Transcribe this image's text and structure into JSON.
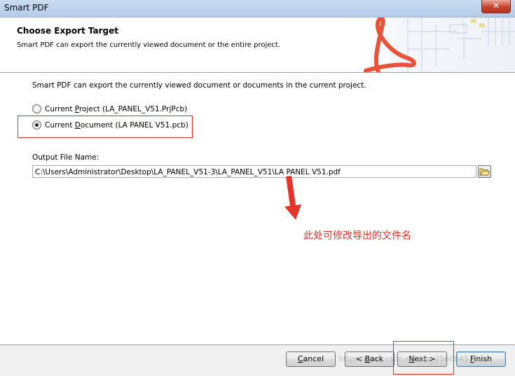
{
  "window": {
    "title": "Smart PDF",
    "close_glyph": "✕"
  },
  "header": {
    "title": "Choose Export Target",
    "subtitle": "Smart PDF can export the currently viewed document or the entire project.",
    "logo_icon": "pdf-logo-icon"
  },
  "body": {
    "description": "Smart PDF can export the currently viewed document or documents in the current project.",
    "options": [
      {
        "pre": "Current ",
        "underlined": "P",
        "post": "roject (LA_PANEL_V51.PrjPcb)",
        "selected": false
      },
      {
        "pre": "Current ",
        "underlined": "D",
        "post": "ocument (LA PANEL V51.pcb)",
        "selected": true
      }
    ],
    "output_label": "Output File Name:",
    "output_path": "C:\\Users\\Administrator\\Desktop\\LA_PANEL_V51-3\\LA_PANEL_V51\\LA PANEL V51.pdf",
    "browse_icon": "folder-open-icon"
  },
  "annotation": {
    "text": "此处可修改导出的文件名",
    "color": "#e53329"
  },
  "footer": {
    "cancel": {
      "pre": "",
      "underlined": "C",
      "post": "ancel"
    },
    "back": {
      "pre": "< ",
      "underlined": "B",
      "post": "ack"
    },
    "next": {
      "pre": "",
      "underlined": "N",
      "post": "ext >"
    },
    "finish": {
      "pre": "",
      "underlined": "F",
      "post": "inish"
    }
  },
  "watermark": "https://blog.csdn.net/qq_2560845"
}
